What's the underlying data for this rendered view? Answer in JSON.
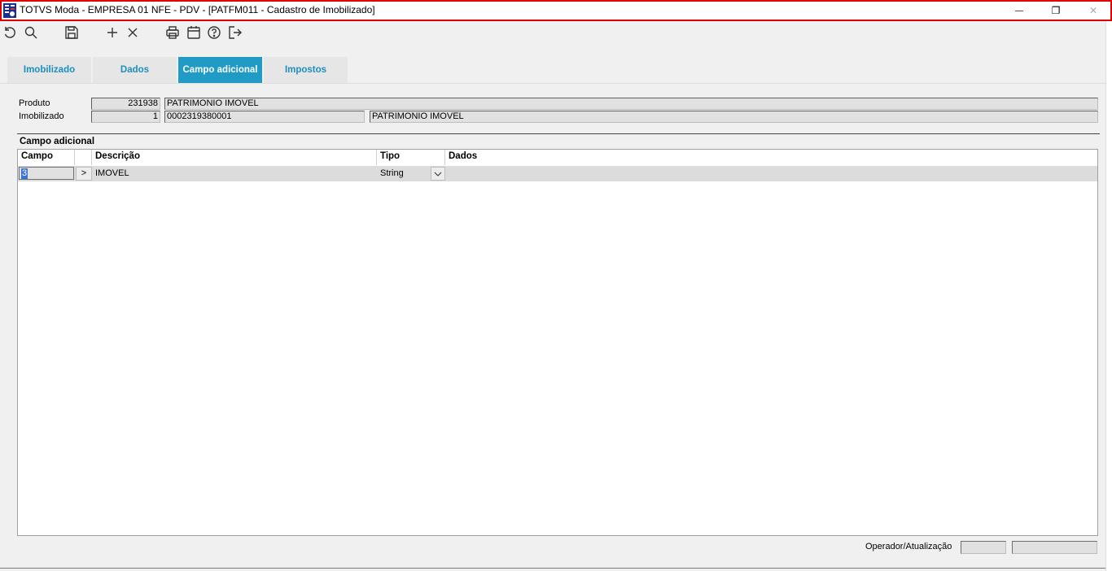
{
  "window": {
    "title": "TOTVS Moda - EMPRESA 01 NFE - PDV - [PATFM011 - Cadastro de Imobilizado]",
    "minimize_glyph": "—",
    "restore_glyph": "❐",
    "close_glyph": "✕"
  },
  "toolbar": {
    "icons": [
      "undo-icon",
      "search-icon",
      "save-icon",
      "add-icon",
      "delete-icon",
      "print-icon",
      "calendar-icon",
      "help-icon",
      "exit-icon"
    ]
  },
  "tabs": [
    {
      "label": "Imobilizado",
      "active": false
    },
    {
      "label": "Dados",
      "active": false
    },
    {
      "label": "Campo adicional",
      "active": true
    },
    {
      "label": "Impostos",
      "active": false
    }
  ],
  "header": {
    "produto_label": "Produto",
    "produto_code": "231938",
    "produto_desc": "PATRIMONIO IMOVEL",
    "imobilizado_label": "Imobilizado",
    "imobilizado_seq": "1",
    "imobilizado_code": "0002319380001",
    "imobilizado_desc": "PATRIMONIO IMOVEL"
  },
  "section": {
    "title": "Campo adicional"
  },
  "grid": {
    "columns": [
      "Campo",
      "Descrição",
      "Tipo",
      "Dados"
    ],
    "rows": [
      {
        "campo": "3",
        "lookup": ">",
        "descricao": "IMOVEL",
        "tipo": "String",
        "dados": ""
      }
    ]
  },
  "footer": {
    "label": "Operador/Atualização",
    "operador": "",
    "atualizacao": ""
  },
  "colors": {
    "active_tab": "#1f9bc6",
    "tab_text": "#1a8fc0",
    "title_border": "#e00000",
    "selection": "#3874d1"
  }
}
